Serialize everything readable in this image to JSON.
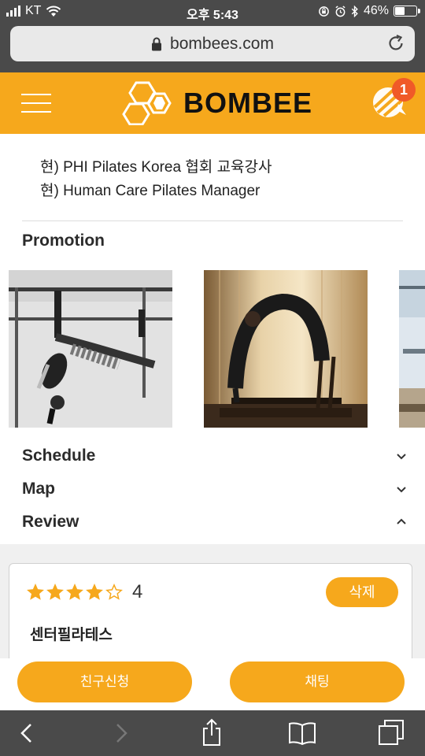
{
  "status_bar": {
    "carrier": "KT",
    "time": "오후 5:43",
    "battery": "46%",
    "battery_level": 0.46
  },
  "browser": {
    "url": "bombees.com"
  },
  "header": {
    "brand": "BOMBEE",
    "notification_count": "1",
    "accent_color": "#f6a81c"
  },
  "career": {
    "lines": [
      "현) PHI Pilates Korea 협회 교육강사",
      "현) Human Care Pilates Manager"
    ]
  },
  "sections": {
    "promotion": "Promotion",
    "schedule": "Schedule",
    "map": "Map",
    "review": "Review"
  },
  "promotions": [
    {
      "alt": "pilates-aerial-photo"
    },
    {
      "alt": "pilates-reformer-photo"
    },
    {
      "alt": "pilates-studio-photo"
    }
  ],
  "review": {
    "rating": "4",
    "stars_filled": 4,
    "stars_total": 5,
    "delete_label": "삭제",
    "reviewer": "센터필라테스"
  },
  "actions": {
    "friend_request": "친구신청",
    "chat": "채팅"
  },
  "toolbar": {
    "icons": [
      "back-icon",
      "forward-icon",
      "share-icon",
      "bookmarks-icon",
      "tabs-icon"
    ]
  }
}
